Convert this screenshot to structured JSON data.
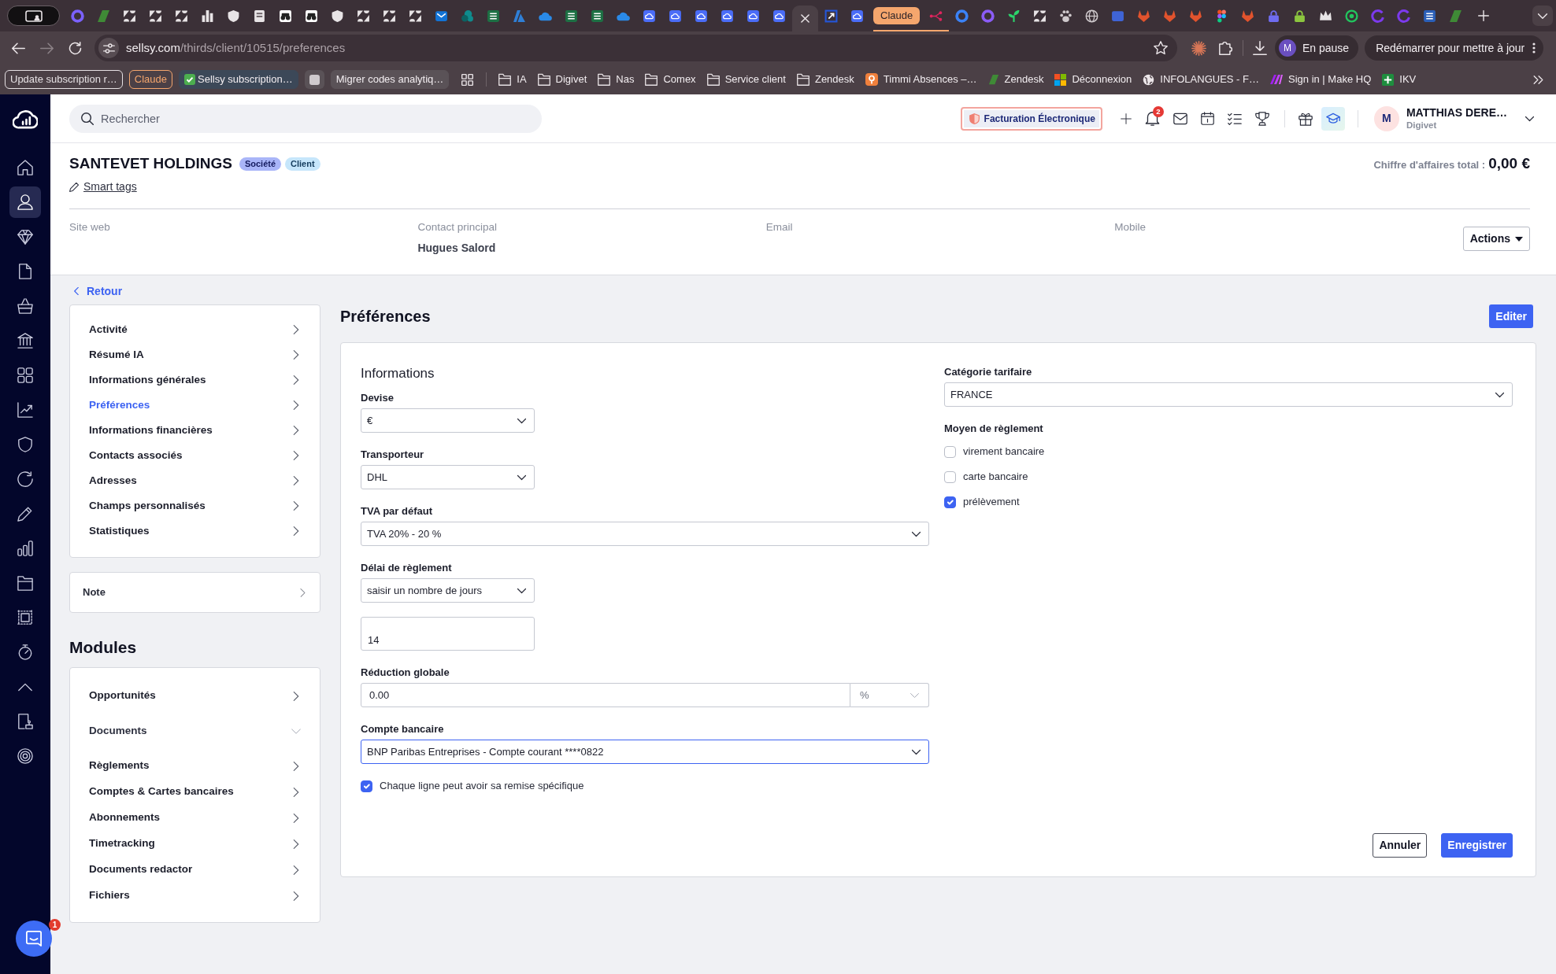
{
  "browser": {
    "tabs": [
      {
        "kind": "ring",
        "color": "#7b61ff",
        "selected": false
      },
      {
        "kind": "slant",
        "color": "#3f8a36",
        "selected": false
      },
      {
        "kind": "triangles",
        "color": "#e8e4e6",
        "selected": false
      },
      {
        "kind": "triangles",
        "color": "#e8e4e6",
        "selected": false
      },
      {
        "kind": "triangles",
        "color": "#e8e4e6",
        "selected": false
      },
      {
        "kind": "bars",
        "color": "#e8e4e6",
        "selected": false
      },
      {
        "kind": "shield",
        "color": "#e8e4e6",
        "selected": false
      },
      {
        "kind": "book",
        "color": "#e8e4e6",
        "selected": false
      },
      {
        "kind": "binoculars",
        "color": "#ffffff",
        "selected": false
      },
      {
        "kind": "binoculars",
        "color": "#ffffff",
        "selected": false
      },
      {
        "kind": "shield",
        "color": "#e8e4e6",
        "selected": false
      },
      {
        "kind": "triangles",
        "color": "#e8e4e6",
        "selected": false
      },
      {
        "kind": "triangles",
        "color": "#e8e4e6",
        "selected": false
      },
      {
        "kind": "triangles",
        "color": "#e8e4e6",
        "selected": false
      },
      {
        "kind": "envelope",
        "color": "#1273d6",
        "selected": false
      },
      {
        "kind": "circles",
        "color": "#0f8b8d",
        "selected": false
      },
      {
        "kind": "sheet",
        "color": "#1d7044",
        "selected": false
      },
      {
        "kind": "wedge",
        "color": "#2f7fd6",
        "selected": false
      },
      {
        "kind": "cloud",
        "color": "#2a8ae8",
        "selected": false
      },
      {
        "kind": "sheet",
        "color": "#1d7044",
        "selected": false
      },
      {
        "kind": "sheet",
        "color": "#1d7044",
        "selected": false
      },
      {
        "kind": "cloud",
        "color": "#2a8ae8",
        "selected": false
      },
      {
        "kind": "cloudtile",
        "color": "#4a6cf7",
        "selected": false
      },
      {
        "kind": "cloudtile",
        "color": "#4a6cf7",
        "selected": false
      },
      {
        "kind": "cloudtile",
        "color": "#4a6cf7",
        "selected": false
      },
      {
        "kind": "cloudtile",
        "color": "#4a6cf7",
        "selected": false
      },
      {
        "kind": "cloudtile",
        "color": "#4a6cf7",
        "selected": false
      },
      {
        "kind": "cloudtile",
        "color": "#4a6cf7",
        "selected": false
      },
      {
        "selected": true
      },
      {
        "kind": "arrowbox",
        "color": "#2456d8",
        "selected": false
      },
      {
        "kind": "cloudtile",
        "color": "#4a6cf7",
        "selected": false
      }
    ],
    "tab_group": {
      "label": "Claude",
      "color": "#f5a66d",
      "tabs": [
        {
          "kind": "nodes",
          "color": "#e0245e",
          "selected": false
        }
      ]
    },
    "more_tabs": [
      {
        "kind": "ring",
        "color": "#3b82f6",
        "selected": false
      },
      {
        "kind": "ring",
        "color": "#8b5cf6",
        "selected": false
      },
      {
        "kind": "sprout",
        "color": "#2bd46b",
        "selected": false
      },
      {
        "kind": "triangles",
        "color": "#e8e4e6",
        "selected": false
      },
      {
        "kind": "paw",
        "color": "#cfc9cc",
        "selected": false
      },
      {
        "kind": "globe",
        "color": "#cfc9cc",
        "selected": false
      },
      {
        "kind": "tile",
        "color": "#3f64d6",
        "selected": false
      },
      {
        "kind": "fox",
        "color": "#e2532d",
        "selected": false
      },
      {
        "kind": "fox",
        "color": "#e2532d",
        "selected": false
      },
      {
        "kind": "fox",
        "color": "#e2532d",
        "selected": false
      },
      {
        "kind": "dots",
        "selected": false
      },
      {
        "kind": "fox",
        "color": "#e2532d",
        "selected": false
      },
      {
        "kind": "lock",
        "color": "#6f6cf0",
        "selected": false
      },
      {
        "kind": "lock",
        "color": "#8cc63f",
        "selected": false
      },
      {
        "kind": "crown",
        "color": "#e8e4e6",
        "selected": false
      },
      {
        "kind": "target",
        "color": "#22c55e",
        "selected": false
      },
      {
        "kind": "arc",
        "color": "#7c3aed",
        "selected": false
      },
      {
        "kind": "arc",
        "color": "#7c3aed",
        "selected": false
      },
      {
        "kind": "sheet",
        "color": "#2b5fb8",
        "selected": false
      },
      {
        "kind": "slant",
        "color": "#3f8a36",
        "selected": false
      }
    ],
    "history": [
      {
        "kind": "back",
        "disabled": false
      },
      {
        "kind": "forward",
        "disabled": true
      }
    ],
    "address": {
      "host": "sellsy.com",
      "path": "/thirds/client/10515/preferences"
    },
    "profile": {
      "initial": "M",
      "status": "En pause"
    },
    "update": {
      "label": "Redémarrer pour mettre à jour"
    },
    "saved_groups": [
      {
        "kind": "outline",
        "label": "Update subscription r…",
        "color": "#e6e1e4"
      },
      {
        "kind": "outline",
        "label": "Claude",
        "color": "#f5a66d"
      },
      {
        "kind": "checked",
        "label": "Sellsy subscription…",
        "color": "#3c4858"
      },
      {
        "kind": "swatch",
        "color": "#cfcacd"
      },
      {
        "kind": "filled",
        "label": "Migrer codes analytiq…",
        "color": "#5a5257"
      }
    ],
    "bookmarks": [
      {
        "kind": "folder",
        "label": "IA"
      },
      {
        "kind": "folder",
        "label": "Digivet"
      },
      {
        "kind": "folder",
        "label": "Nas"
      },
      {
        "kind": "folder",
        "label": "Comex"
      },
      {
        "kind": "folder",
        "label": "Service client"
      },
      {
        "kind": "folder",
        "label": "Zendesk"
      },
      {
        "kind": "pin",
        "label": "Timmi Absences –…"
      },
      {
        "kind": "slant",
        "label": "Zendesk"
      },
      {
        "kind": "squares",
        "label": "Déconnexion"
      },
      {
        "kind": "globe",
        "label": "INFOLANGUES - F…"
      },
      {
        "kind": "slashes",
        "label": "Sign in | Make HQ"
      },
      {
        "kind": "cross",
        "label": "IKV"
      }
    ]
  },
  "sidebar": {
    "items": [
      {
        "kind": "home",
        "selected": false
      },
      {
        "kind": "person",
        "selected": true
      },
      {
        "kind": "diamond",
        "selected": false
      },
      {
        "kind": "document",
        "selected": false
      },
      {
        "kind": "basket",
        "selected": false
      },
      {
        "kind": "bank",
        "selected": false
      },
      {
        "kind": "grid",
        "selected": false
      },
      {
        "kind": "chart",
        "selected": false
      },
      {
        "kind": "shield",
        "selected": false
      },
      {
        "kind": "refresh",
        "selected": false
      },
      {
        "kind": "pencil",
        "selected": false
      },
      {
        "kind": "bars",
        "selected": false
      },
      {
        "kind": "folder",
        "selected": false
      },
      {
        "kind": "stamp",
        "selected": false
      },
      {
        "kind": "stopwatch",
        "selected": false
      },
      {
        "kind": "collapse",
        "selected": false
      },
      {
        "kind": "docstamp",
        "selected": false
      },
      {
        "kind": "target",
        "selected": false
      }
    ]
  },
  "chat_launcher": {
    "badge": "1"
  },
  "topbar": {
    "search": {
      "placeholder": "Rechercher"
    },
    "einvoice": {
      "label": "Facturation Électronique"
    },
    "notifications": {
      "badge": "2"
    },
    "user": {
      "initial": "M",
      "name": "MATTHIAS DERE…",
      "company": "Digivet"
    }
  },
  "company": {
    "name": "SANTEVET HOLDINGS",
    "badges": [
      {
        "label": "Société",
        "color": "#a9b5f8"
      },
      {
        "label": "Client",
        "color": "#c6e6fb"
      }
    ],
    "smart_tags": "Smart tags",
    "revenue_label": "Chiffre d'affaires total :",
    "revenue": "0,00 €",
    "fields": [
      {
        "label": "Site web"
      },
      {
        "label": "Contact principal",
        "value": "Hugues Salord"
      },
      {
        "label": "Email"
      },
      {
        "label": "Mobile"
      }
    ],
    "actions": "Actions"
  },
  "back_link": "Retour",
  "menu": [
    {
      "label": "Activité",
      "selected": false
    },
    {
      "label": "Résumé IA",
      "selected": false
    },
    {
      "label": "Informations générales",
      "selected": false
    },
    {
      "label": "Préférences",
      "selected": true
    },
    {
      "label": "Informations financières",
      "selected": false
    },
    {
      "label": "Contacts associés",
      "selected": false
    },
    {
      "label": "Adresses",
      "selected": false
    },
    {
      "label": "Champs personnalisés",
      "selected": false
    },
    {
      "label": "Statistiques",
      "selected": false
    }
  ],
  "note": {
    "label": "Note"
  },
  "modules": {
    "title": "Modules",
    "items": [
      {
        "label": "Opportunités",
        "kind": "link"
      },
      {
        "label": "Documents",
        "kind": "group"
      },
      {
        "label": "Règlements",
        "kind": "link"
      },
      {
        "label": "Comptes & Cartes bancaires",
        "kind": "link"
      },
      {
        "label": "Abonnements",
        "kind": "link"
      },
      {
        "label": "Timetracking",
        "kind": "link"
      },
      {
        "label": "Documents redactor",
        "kind": "link"
      },
      {
        "label": "Fichiers",
        "kind": "link"
      }
    ]
  },
  "panel": {
    "title": "Préférences",
    "edit": "Editer",
    "left": {
      "heading": "Informations",
      "fields": [
        {
          "kind": "picker",
          "label": "Devise",
          "value": "€",
          "focused": false
        },
        {
          "kind": "picker",
          "label": "Transporteur",
          "value": "DHL",
          "focused": false
        },
        {
          "kind": "select",
          "label": "TVA par défaut",
          "value": "TVA 20% - 20 %",
          "focused": false
        },
        {
          "kind": "picker",
          "label": "Délai de règlement",
          "value": "saisir un nombre de jours",
          "focused": false
        },
        {
          "kind": "textbox",
          "value": "14"
        },
        {
          "kind": "discount",
          "label": "Réduction globale",
          "value": "0.00",
          "unit": {
            "value": "%",
            "disabled": true
          }
        },
        {
          "kind": "select",
          "label": "Compte bancaire",
          "value": "BNP Paribas Entreprises - Compte courant ****0822",
          "focused": true
        },
        {
          "kind": "checkbox",
          "label": "Chaque ligne peut avoir sa remise spécifique",
          "checked": true
        }
      ]
    },
    "right": {
      "fields": [
        {
          "kind": "select",
          "label": "Catégorie tarifaire",
          "value": "FRANCE",
          "focused": false
        },
        {
          "kind": "options",
          "label": "Moyen de règlement",
          "options": [
            {
              "label": "virement bancaire",
              "checked": false
            },
            {
              "label": "carte bancaire",
              "checked": false
            },
            {
              "label": "prélèvement",
              "checked": true
            }
          ]
        }
      ]
    },
    "buttons": [
      {
        "label": "Annuler",
        "kind": "secondary"
      },
      {
        "label": "Enregistrer",
        "kind": "primary"
      }
    ]
  }
}
